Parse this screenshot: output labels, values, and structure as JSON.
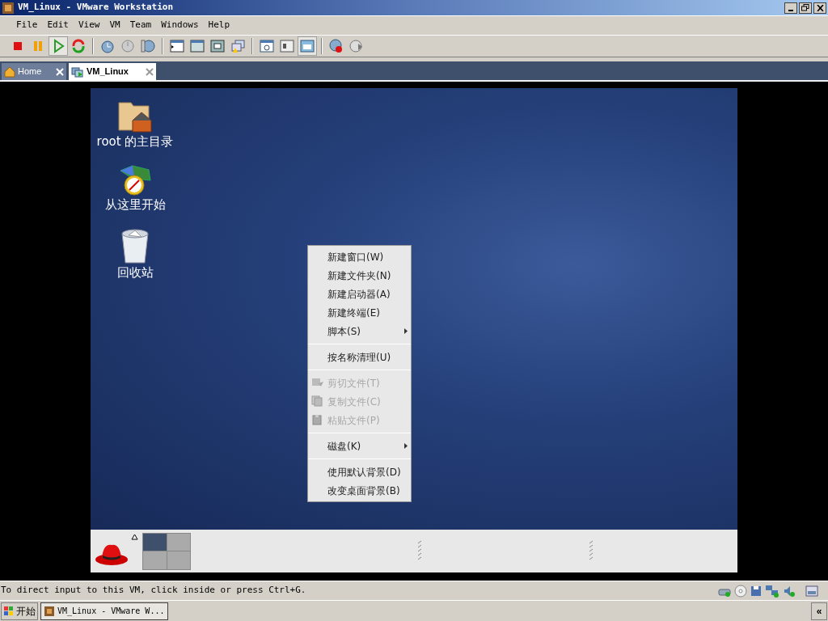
{
  "window": {
    "title": "VM_Linux - VMware Workstation"
  },
  "menu_bar": [
    "File",
    "Edit",
    "View",
    "VM",
    "Team",
    "Windows",
    "Help"
  ],
  "toolbar": [
    {
      "kind": "stop",
      "selected": false
    },
    {
      "kind": "pause",
      "selected": false
    },
    {
      "kind": "play",
      "selected": true
    },
    {
      "kind": "reset",
      "selected": false
    },
    {
      "kind": "sep"
    },
    {
      "kind": "snapshot",
      "selected": false
    },
    {
      "kind": "revert",
      "selected": false
    },
    {
      "kind": "manager",
      "selected": false
    },
    {
      "kind": "sep"
    },
    {
      "kind": "sidebar",
      "selected": false
    },
    {
      "kind": "quickswitch",
      "selected": false
    },
    {
      "kind": "fullscreen",
      "selected": false
    },
    {
      "kind": "unity",
      "selected": false
    },
    {
      "kind": "sep"
    },
    {
      "kind": "settings",
      "selected": false
    },
    {
      "kind": "console",
      "selected": false
    },
    {
      "kind": "view",
      "selected": true
    },
    {
      "kind": "sep"
    },
    {
      "kind": "record",
      "selected": false
    },
    {
      "kind": "replay",
      "selected": false
    }
  ],
  "tabs": [
    {
      "label": "Home",
      "selected": false,
      "kind": "home"
    },
    {
      "label": "VM_Linux",
      "selected": true,
      "kind": "vm"
    }
  ],
  "desktop_icons": [
    {
      "label": "root 的主目录",
      "kind": "home"
    },
    {
      "label": "从这里开始",
      "kind": "start"
    },
    {
      "label": "回收站",
      "kind": "trash"
    }
  ],
  "context_menu": [
    {
      "kind": "item",
      "text": "新建窗口(W)",
      "disabled": false,
      "submenu": false
    },
    {
      "kind": "item",
      "text": "新建文件夹(N)",
      "disabled": false,
      "submenu": false
    },
    {
      "kind": "item",
      "text": "新建启动器(A)",
      "disabled": false,
      "submenu": false
    },
    {
      "kind": "item",
      "text": "新建终端(E)",
      "disabled": false,
      "submenu": false
    },
    {
      "kind": "item",
      "text": "脚本(S)",
      "disabled": false,
      "submenu": true
    },
    {
      "kind": "separator"
    },
    {
      "kind": "item",
      "text": "按名称清理(U)",
      "disabled": false,
      "submenu": false
    },
    {
      "kind": "separator"
    },
    {
      "kind": "cut",
      "text": "剪切文件(T)",
      "disabled": true,
      "submenu": false
    },
    {
      "kind": "copy",
      "text": "复制文件(C)",
      "disabled": true,
      "submenu": false
    },
    {
      "kind": "paste",
      "text": "粘贴文件(P)",
      "disabled": true,
      "submenu": false
    },
    {
      "kind": "separator"
    },
    {
      "kind": "item",
      "text": "磁盘(K)",
      "disabled": false,
      "submenu": true
    },
    {
      "kind": "separator"
    },
    {
      "kind": "item",
      "text": "使用默认背景(D)",
      "disabled": false,
      "submenu": false
    },
    {
      "kind": "item",
      "text": "改变桌面背景(B)",
      "disabled": false,
      "submenu": false
    }
  ],
  "panel": {
    "workspaces": [
      {
        "selected": true
      },
      {
        "selected": false
      },
      {
        "selected": false
      },
      {
        "selected": false
      }
    ]
  },
  "status_bar": {
    "text": "To direct input to this VM, click inside or press Ctrl+G."
  },
  "taskbar": {
    "start": "开始",
    "tasks": [
      {
        "label": "VM_Linux - VMware W...",
        "selected": true
      }
    ],
    "tray_toggle": "«"
  }
}
